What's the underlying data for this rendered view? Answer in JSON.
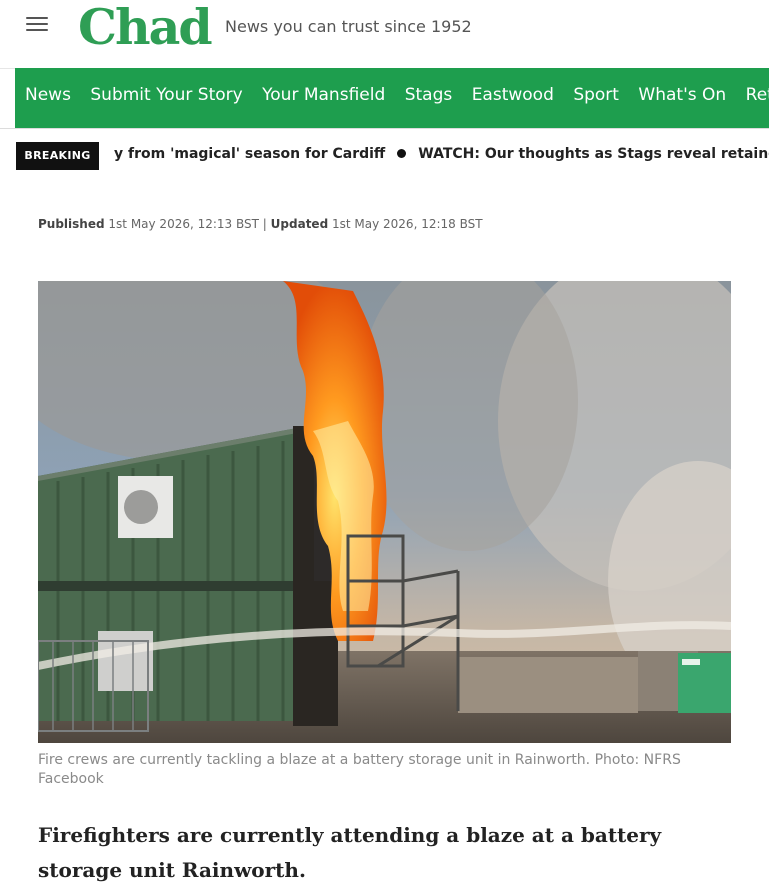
{
  "header": {
    "logo_text": "Chad",
    "tagline": "News you can trust since 1952",
    "menu_icon": "hamburger-menu-icon",
    "brand_color": "#1e9e4e"
  },
  "nav": {
    "items": [
      "News",
      "Submit Your Story",
      "Your Mansfield",
      "Stags",
      "Eastwood",
      "Sport",
      "What's On",
      "Retro"
    ]
  },
  "breaking": {
    "label": "BREAKING",
    "items": [
      "y from 'magical' season for Cardiff",
      "WATCH: Our thoughts as Stags reveal retained list"
    ]
  },
  "article": {
    "published_label": "Published",
    "published_time": "1st May 2026, 12:13 BST",
    "separator": "|",
    "updated_label": "Updated",
    "updated_time": "1st May 2026, 12:18 BST",
    "image_caption": "Fire crews are currently tackling a blaze at a battery storage unit in Rainworth. Photo: NFRS Facebook",
    "lede": "Firefighters are currently attending a blaze at a battery storage unit Rainworth."
  }
}
